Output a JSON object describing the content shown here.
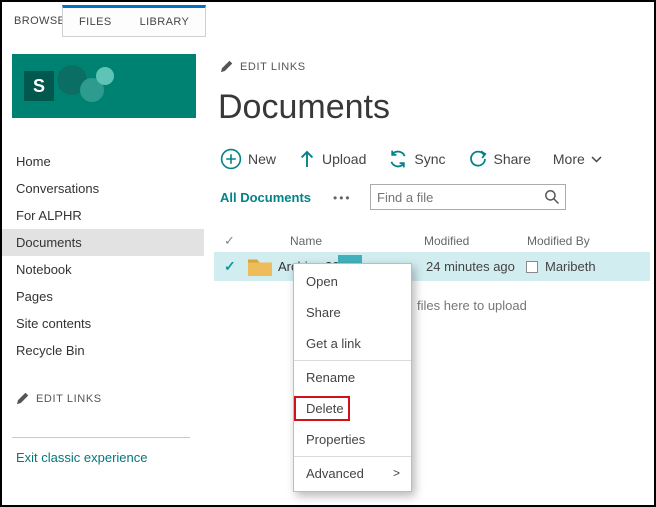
{
  "ribbon": {
    "tabs": [
      {
        "label": "BROWSE"
      },
      {
        "label": "FILES"
      },
      {
        "label": "LIBRARY"
      }
    ]
  },
  "sidebar": {
    "logo_text": "S",
    "nav": [
      "Home",
      "Conversations",
      "For ALPHR",
      "Documents",
      "Notebook",
      "Pages",
      "Site contents",
      "Recycle Bin"
    ],
    "selected_item": "Documents",
    "edit_links": "EDIT LINKS",
    "exit_classic": "Exit classic experience"
  },
  "main": {
    "edit_links": "EDIT LINKS",
    "title": "Documents",
    "toolbar": {
      "new": "New",
      "upload": "Upload",
      "sync": "Sync",
      "share": "Share",
      "more": "More"
    },
    "view_selector": "All Documents",
    "view_ellipsis": "•••",
    "search_placeholder": "Find a file",
    "columns": {
      "name": "Name",
      "modified": "Modified",
      "modified_by": "Modified By"
    },
    "row": {
      "name": "Archive 2021",
      "modified": "24 minutes ago",
      "modified_by": "Maribeth"
    },
    "dropzone_text": "files here to upload"
  },
  "context_menu": {
    "items": [
      "Open",
      "Share",
      "Get a link",
      "Rename",
      "Delete",
      "Properties",
      "Advanced"
    ],
    "advanced_marker": ">",
    "highlighted_item": "Delete"
  },
  "icons": {
    "check": "✓"
  },
  "colors": {
    "brand_teal": "#008272",
    "accent_teal": "#038387",
    "row_selected_bg": "#d2edf0",
    "tab_accent_blue": "#0072c6",
    "annotation_red": "#d0131b",
    "folder_yellow": "#eebc5a"
  }
}
